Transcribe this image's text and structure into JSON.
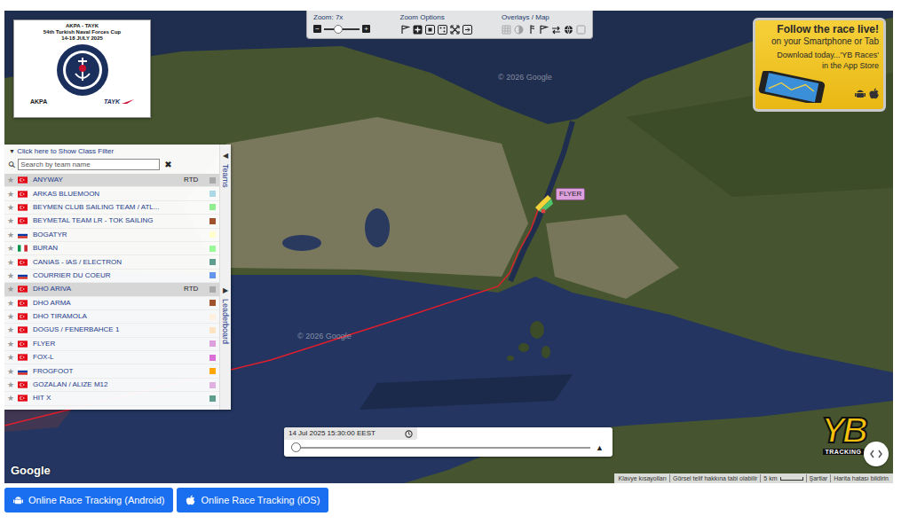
{
  "event_logo": {
    "title": "AKPA - TAYK",
    "subtitle": "54th Turkish Naval Forces Cup",
    "dates": "14-18 JULY 2025",
    "sponsors": [
      "AKPA",
      "TAYK"
    ]
  },
  "toolbar": {
    "zoom_label": "Zoom: 7x",
    "zoom_minus": "−",
    "zoom_plus": "+",
    "zoom_level": 0.4,
    "zoom_options_label": "Zoom Options",
    "zoom_options": [
      {
        "kind": "flag"
      },
      {
        "kind": "plus"
      },
      {
        "kind": "fit"
      },
      {
        "kind": "dots"
      },
      {
        "kind": "expand"
      },
      {
        "kind": "exit"
      }
    ],
    "overlays_label": "Overlays / Map",
    "overlays": [
      {
        "kind": "grid",
        "enabled": false
      },
      {
        "kind": "contrast",
        "enabled": false
      },
      {
        "kind": "wind",
        "enabled": true
      },
      {
        "kind": "flag",
        "enabled": true
      },
      {
        "kind": "arrows",
        "enabled": true
      },
      {
        "kind": "globe",
        "enabled": true
      },
      {
        "kind": "box",
        "enabled": false
      }
    ]
  },
  "ad": {
    "headline": "Follow the race live!",
    "line1": "on your Smartphone or Tab",
    "line2": "Download today...'YB Races'",
    "line3": "in the App Store"
  },
  "team_panel": {
    "toggle_icon": "▼",
    "class_filter": "Click here to Show Class Filter",
    "search_icon": "⚲",
    "search_placeholder": "Search by team name",
    "clear_icon": "✖",
    "favorite_icon": "★",
    "tabs": [
      {
        "label": "Teams",
        "arrow": "◀"
      },
      {
        "label": "Leaderboard",
        "arrow": "▶"
      }
    ],
    "teams": [
      {
        "name": "ANYWAY",
        "country": "TR",
        "status": "RTD",
        "highlighted": true,
        "color": "#a9a9a9"
      },
      {
        "name": "ARKAS BLUEMOON",
        "country": "TR",
        "status": "",
        "highlighted": false,
        "color": "#add8e6"
      },
      {
        "name": "BEYMEN CLUB SAILING TEAM / ATL...",
        "country": "TR",
        "status": "",
        "highlighted": false,
        "color": "#90ee90"
      },
      {
        "name": "BEYMETAL TEAM LR - TOK SAILING",
        "country": "TR",
        "status": "",
        "highlighted": false,
        "color": "#a0522d"
      },
      {
        "name": "BOGATYR",
        "country": "RU",
        "status": "",
        "highlighted": false,
        "color": "#ffffcc"
      },
      {
        "name": "BURAN",
        "country": "IT",
        "status": "",
        "highlighted": false,
        "color": "#98fb98"
      },
      {
        "name": "CANIAS - IAS / ELECTRON",
        "country": "TR",
        "status": "",
        "highlighted": false,
        "color": "#5f9e8f"
      },
      {
        "name": "COURRIER DU COEUR",
        "country": "RU",
        "status": "",
        "highlighted": false,
        "color": "#6495ed"
      },
      {
        "name": "DHO ARIVA",
        "country": "TR",
        "status": "RTD",
        "highlighted": true,
        "color": "#a9a9a9"
      },
      {
        "name": "DHO ARMA",
        "country": "TR",
        "status": "",
        "highlighted": false,
        "color": "#a0522d"
      },
      {
        "name": "DHO TIRAMOLA",
        "country": "TR",
        "status": "",
        "highlighted": false,
        "color": "#fff0e0"
      },
      {
        "name": "DOGUS / FENERBAHCE 1",
        "country": "TR",
        "status": "",
        "highlighted": false,
        "color": "#ffe4c4"
      },
      {
        "name": "FLYER",
        "country": "TR",
        "status": "",
        "highlighted": false,
        "color": "#dda0dd"
      },
      {
        "name": "FOX-L",
        "country": "TR",
        "status": "",
        "highlighted": false,
        "color": "#da70d6"
      },
      {
        "name": "FROGFOOT",
        "country": "RU",
        "status": "",
        "highlighted": false,
        "color": "#ffa500"
      },
      {
        "name": "GOZALAN / ALIZE M12",
        "country": "TR",
        "status": "",
        "highlighted": false,
        "color": "#e0b0e0"
      },
      {
        "name": "HIT X",
        "country": "TR",
        "status": "",
        "highlighted": false,
        "color": "#5f9e8f"
      }
    ]
  },
  "map": {
    "watermark": "© 2026 Google",
    "boats": [
      {
        "name": "FLYER",
        "color": "#dda0dd"
      }
    ],
    "google_logo": "Google",
    "attribution": [
      "Klavye kısayolları",
      "Görsel telif hakkına tabi olabilir",
      "5 km",
      "Şartlar",
      "Harita hatası bildirin"
    ]
  },
  "timeline": {
    "time": "14 Jul 2025 15:30:00 EEST",
    "level": 0.0,
    "play_icon": "▲"
  },
  "brand": {
    "mark": "YB",
    "caption": "TRACKING"
  },
  "buttons": [
    {
      "label": "Online Race Tracking (Android)",
      "platform": "android"
    },
    {
      "label": "Online Race Tracking (iOS)",
      "platform": "ios"
    }
  ]
}
